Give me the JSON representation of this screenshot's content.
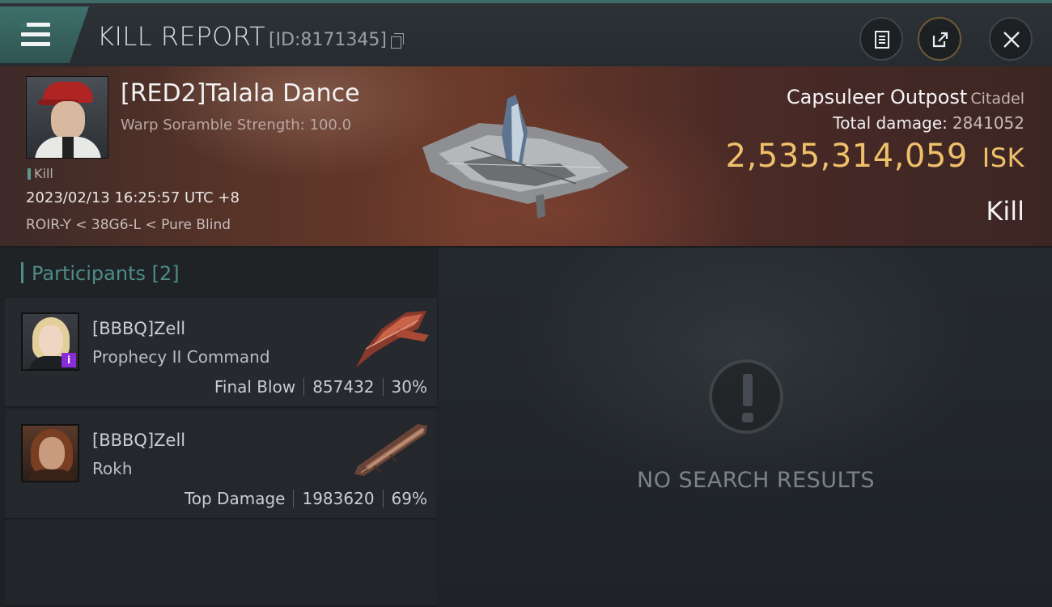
{
  "header": {
    "title": "KILL REPORT",
    "report_id": "[ID:8171345]"
  },
  "victim": {
    "name": "[RED2]Talala Dance",
    "subtitle": "Warp Soramble Strength: 100.0",
    "tag": "Kill",
    "datetime": "2023/02/13 16:25:57 UTC +8",
    "location": "ROIR-Y < 38G6-L < Pure Blind"
  },
  "target": {
    "name": "Capsuleer Outpost",
    "class": "Citadel",
    "damage_label": "Total damage:",
    "damage_value": "2841052",
    "isk_value": "2,535,314,059",
    "isk_unit": "ISK",
    "result": "Kill"
  },
  "participants": {
    "label": "Participants",
    "count": "[2]",
    "items": [
      {
        "name": "[BBBQ]Zell",
        "ship": "Prophecy II Command",
        "role": "Final Blow",
        "damage": "857432",
        "percent": "30%",
        "badge": "i"
      },
      {
        "name": "[BBBQ]Zell",
        "ship": "Rokh",
        "role": "Top Damage",
        "damage": "1983620",
        "percent": "69%"
      }
    ]
  },
  "empty_state": {
    "message": "NO SEARCH RESULTS"
  },
  "colors": {
    "accent": "#4f8c88",
    "isk": "#efc06a",
    "banner": "#6b3a2a"
  }
}
